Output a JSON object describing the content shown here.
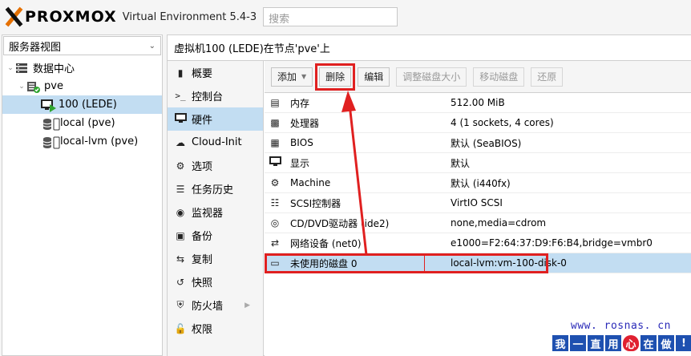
{
  "header": {
    "brand": "PROXMOX",
    "subtitle": "Virtual Environment 5.4-3",
    "search_placeholder": "搜索"
  },
  "sidebar": {
    "view_select": "服务器视图",
    "tree": [
      {
        "label": "数据中心",
        "icon": "datacenter-icon"
      },
      {
        "label": "pve",
        "icon": "server-icon"
      },
      {
        "label": "100 (LEDE)",
        "icon": "vm-running-icon"
      },
      {
        "label": "local (pve)",
        "icon": "storage-icon"
      },
      {
        "label": "local-lvm (pve)",
        "icon": "storage-icon"
      }
    ]
  },
  "main": {
    "title": "虚拟机100 (LEDE)在节点'pve'上",
    "nav": [
      {
        "label": "概要",
        "icon": "book-icon"
      },
      {
        "label": "控制台",
        "icon": "terminal-icon"
      },
      {
        "label": "硬件",
        "icon": "desktop-icon"
      },
      {
        "label": "Cloud-Init",
        "icon": "cloud-icon"
      },
      {
        "label": "选项",
        "icon": "gear-icon"
      },
      {
        "label": "任务历史",
        "icon": "list-icon"
      },
      {
        "label": "监视器",
        "icon": "eye-icon"
      },
      {
        "label": "备份",
        "icon": "floppy-icon"
      },
      {
        "label": "复制",
        "icon": "retweet-icon"
      },
      {
        "label": "快照",
        "icon": "history-icon"
      },
      {
        "label": "防火墙",
        "icon": "shield-icon"
      },
      {
        "label": "权限",
        "icon": "unlock-icon"
      }
    ],
    "toolbar": {
      "add": "添加",
      "delete": "删除",
      "edit": "编辑",
      "resize": "调整磁盘大小",
      "move": "移动磁盘",
      "revert": "还原"
    },
    "hardware": [
      {
        "key": "内存",
        "value": "512.00 MiB",
        "icon": "memory-icon"
      },
      {
        "key": "处理器",
        "value": "4 (1 sockets, 4 cores)",
        "icon": "cpu-icon"
      },
      {
        "key": "BIOS",
        "value": "默认 (SeaBIOS)",
        "icon": "microchip-icon"
      },
      {
        "key": "显示",
        "value": "默认",
        "icon": "monitor-icon"
      },
      {
        "key": "Machine",
        "value": "默认 (i440fx)",
        "icon": "cogs-icon"
      },
      {
        "key": "SCSI控制器",
        "value": "VirtIO SCSI",
        "icon": "database-icon"
      },
      {
        "key": "CD/DVD驱动器 (ide2)",
        "value": "none,media=cdrom",
        "icon": "cdrom-icon"
      },
      {
        "key": "网络设备 (net0)",
        "value": "e1000=F2:64:37:D9:F6:B4,bridge=vmbr0",
        "icon": "exchange-icon"
      },
      {
        "key": "未使用的磁盘 0",
        "value": "local-lvm:vm-100-disk-0",
        "icon": "hdd-icon"
      }
    ]
  },
  "watermark": {
    "url": "www. rosnas. cn",
    "chars": [
      "我",
      "一",
      "直",
      "用",
      "心",
      "在",
      "做",
      "!"
    ]
  }
}
